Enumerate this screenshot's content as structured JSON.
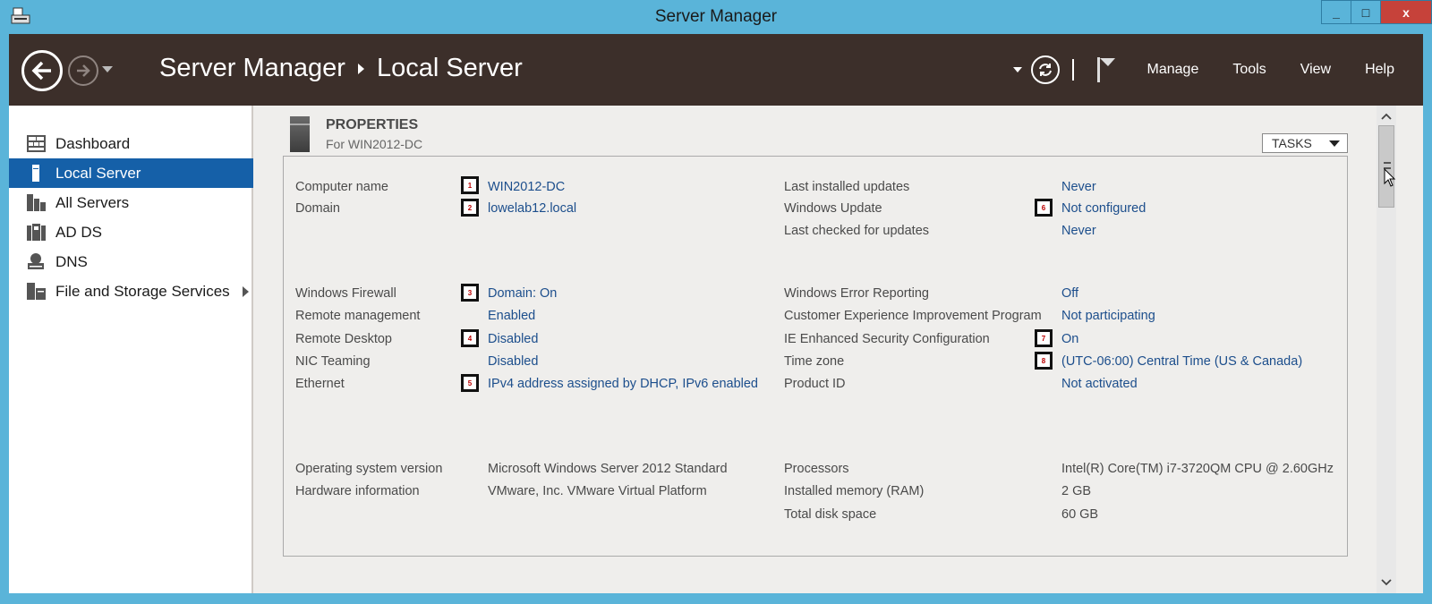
{
  "window": {
    "title": "Server Manager",
    "controls": [
      "_",
      "□",
      "x"
    ]
  },
  "header": {
    "breadcrumb": {
      "root": "Server Manager",
      "current": "Local Server"
    },
    "menu": [
      "Manage",
      "Tools",
      "View",
      "Help"
    ]
  },
  "sidebar": {
    "items": [
      {
        "label": "Dashboard",
        "icon": "dashboard-icon"
      },
      {
        "label": "Local Server",
        "icon": "server-icon",
        "active": true
      },
      {
        "label": "All Servers",
        "icon": "servers-icon"
      },
      {
        "label": "AD DS",
        "icon": "ad-ds-icon"
      },
      {
        "label": "DNS",
        "icon": "dns-icon"
      },
      {
        "label": "File and Storage Services",
        "icon": "storage-icon"
      }
    ]
  },
  "properties": {
    "title": "PROPERTIES",
    "subtitle": "For WIN2012-DC",
    "tasks_label": "TASKS",
    "left": [
      {
        "label": "Computer name",
        "value": "WIN2012-DC",
        "badge": "1"
      },
      {
        "label": "Domain",
        "value": "lowelab12.local",
        "badge": "2"
      },
      {
        "label": "Windows Firewall",
        "value": "Domain: On",
        "badge": "3"
      },
      {
        "label": "Remote management",
        "value": "Enabled"
      },
      {
        "label": "Remote Desktop",
        "value": "Disabled",
        "badge": "4"
      },
      {
        "label": "NIC Teaming",
        "value": "Disabled"
      },
      {
        "label": "Ethernet",
        "value": "IPv4 address assigned by DHCP, IPv6 enabled",
        "badge": "5"
      },
      {
        "label": "Operating system version",
        "value": "Microsoft Windows Server 2012 Standard"
      },
      {
        "label": "Hardware information",
        "value": "VMware, Inc. VMware Virtual Platform"
      }
    ],
    "right": [
      {
        "label": "Last installed updates",
        "value": "Never"
      },
      {
        "label": "Windows Update",
        "value": "Not configured",
        "badge": "6"
      },
      {
        "label": "Last checked for updates",
        "value": "Never"
      },
      {
        "label": "Windows Error Reporting",
        "value": "Off"
      },
      {
        "label": "Customer Experience Improvement Program",
        "value": "Not participating"
      },
      {
        "label": "IE Enhanced Security Configuration",
        "value": "On",
        "badge": "7"
      },
      {
        "label": "Time zone",
        "value": "(UTC-06:00) Central Time (US & Canada)",
        "badge": "8"
      },
      {
        "label": "Product ID",
        "value": "Not activated"
      },
      {
        "label": "Processors",
        "value": "Intel(R) Core(TM) i7-3720QM CPU @ 2.60GHz"
      },
      {
        "label": "Installed memory (RAM)",
        "value": "2 GB"
      },
      {
        "label": "Total disk space",
        "value": "60 GB"
      }
    ]
  },
  "colors": {
    "accent": "#1560a8",
    "header": "#3c2f2a",
    "frame": "#5ab4d9",
    "link": "#1c4e8c"
  }
}
